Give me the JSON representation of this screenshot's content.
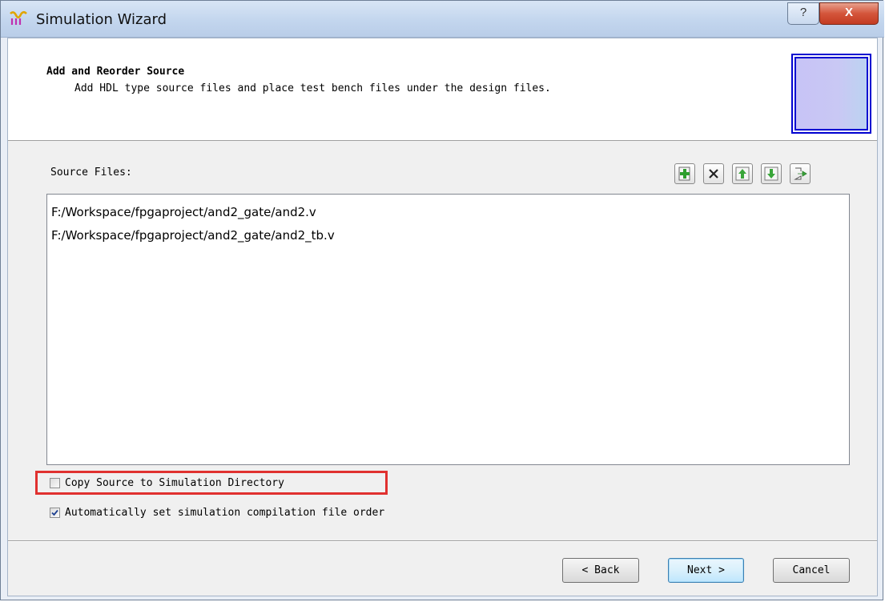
{
  "window": {
    "title": "Simulation Wizard",
    "help_glyph": "?",
    "close_glyph": "X"
  },
  "header": {
    "title": "Add and Reorder Source",
    "subtitle": "Add HDL type source files and place test bench files under the design files."
  },
  "source_files": {
    "label": "Source Files:",
    "toolbar": [
      "add-file-icon",
      "remove-file-icon",
      "move-up-icon",
      "move-down-icon",
      "export-icon"
    ],
    "items": [
      "F:/Workspace/fpgaproject/and2_gate/and2.v",
      "F:/Workspace/fpgaproject/and2_gate/and2_tb.v"
    ]
  },
  "options": {
    "copy_source": {
      "label": "Copy Source to Simulation Directory",
      "checked": false
    },
    "auto_order": {
      "label": "Automatically set simulation compilation file order",
      "checked": true
    }
  },
  "buttons": {
    "back": "< Back",
    "next": "Next >",
    "cancel": "Cancel"
  },
  "colors": {
    "highlight": "#e0312f",
    "header_image_border": "#0000d0"
  }
}
